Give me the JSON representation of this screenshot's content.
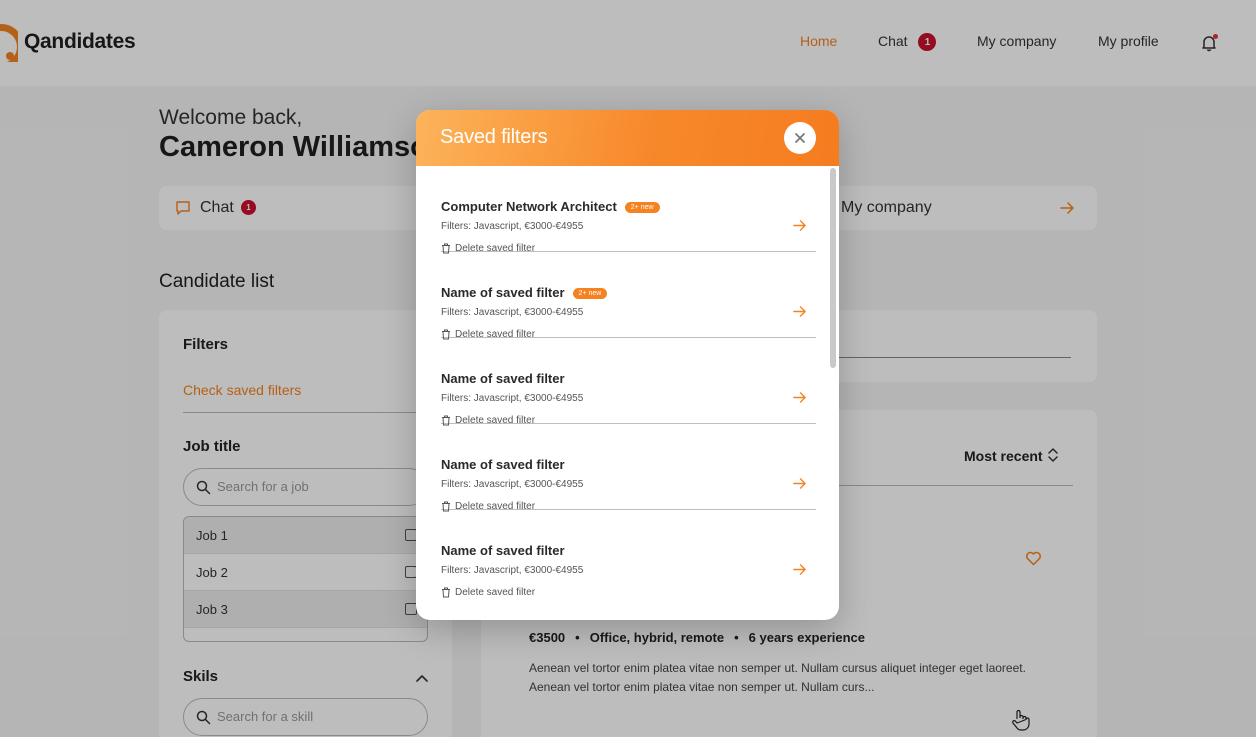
{
  "header": {
    "app_name": "Qandidates",
    "nav": [
      {
        "label": "Home",
        "active": true
      },
      {
        "label": "Chat",
        "badge": "1"
      },
      {
        "label": "My company"
      },
      {
        "label": "My profile"
      }
    ]
  },
  "welcome": {
    "greeting": "Welcome back,",
    "name": "Cameron Williamson"
  },
  "quick_links": {
    "chat": {
      "label": "Chat",
      "badge": "1"
    },
    "company": {
      "label": "My company"
    }
  },
  "candidate_list": {
    "title": "Candidate list",
    "sort_label": "Most recent"
  },
  "filters": {
    "title": "Filters",
    "check_saved": "Check saved filters",
    "job_title": "Job title",
    "job_search_placeholder": "Search for a job",
    "jobs": [
      "Job 1",
      "Job 2",
      "Job 3"
    ],
    "skills_title": "Skils",
    "skill_search_placeholder": "Search for a skill"
  },
  "candidate": {
    "salary": "€3500",
    "work_mode": "Office, hybrid, remote",
    "experience": "6 years experience",
    "description": "Aenean vel tortor enim platea vitae non semper ut. Nullam cursus aliquet integer eget laoreet. Aenean vel tortor enim platea vitae non semper ut. Nullam curs..."
  },
  "modal": {
    "title": "Saved filters",
    "items": [
      {
        "name": "Computer Network Architect",
        "badge": "2+ new",
        "desc": "Filters: Javascript, €3000-€4955",
        "delete_label": "Delete saved filter"
      },
      {
        "name": "Name of saved filter",
        "badge": "2+ new",
        "desc": "Filters: Javascript, €3000-€4955",
        "delete_label": "Delete saved filter"
      },
      {
        "name": "Name of saved filter",
        "desc": "Filters: Javascript, €3000-€4955",
        "delete_label": "Delete saved filter"
      },
      {
        "name": "Name of saved filter",
        "desc": "Filters: Javascript, €3000-€4955",
        "delete_label": "Delete saved filter"
      },
      {
        "name": "Name of saved filter",
        "desc": "Filters: Javascript, €3000-€4955",
        "delete_label": "Delete saved filter"
      }
    ]
  },
  "icons": {
    "bell": "bell-icon",
    "chat": "chat-bubble-icon",
    "arrow": "arrow-right-icon",
    "close": "close-icon",
    "trash": "trash-icon",
    "search": "search-icon",
    "heart": "heart-icon",
    "sort": "sort-icon",
    "chevron": "chevron-up-icon",
    "cursor": "hand-cursor-icon"
  },
  "colors": {
    "accent": "#f58220",
    "badge": "#c8102e"
  }
}
